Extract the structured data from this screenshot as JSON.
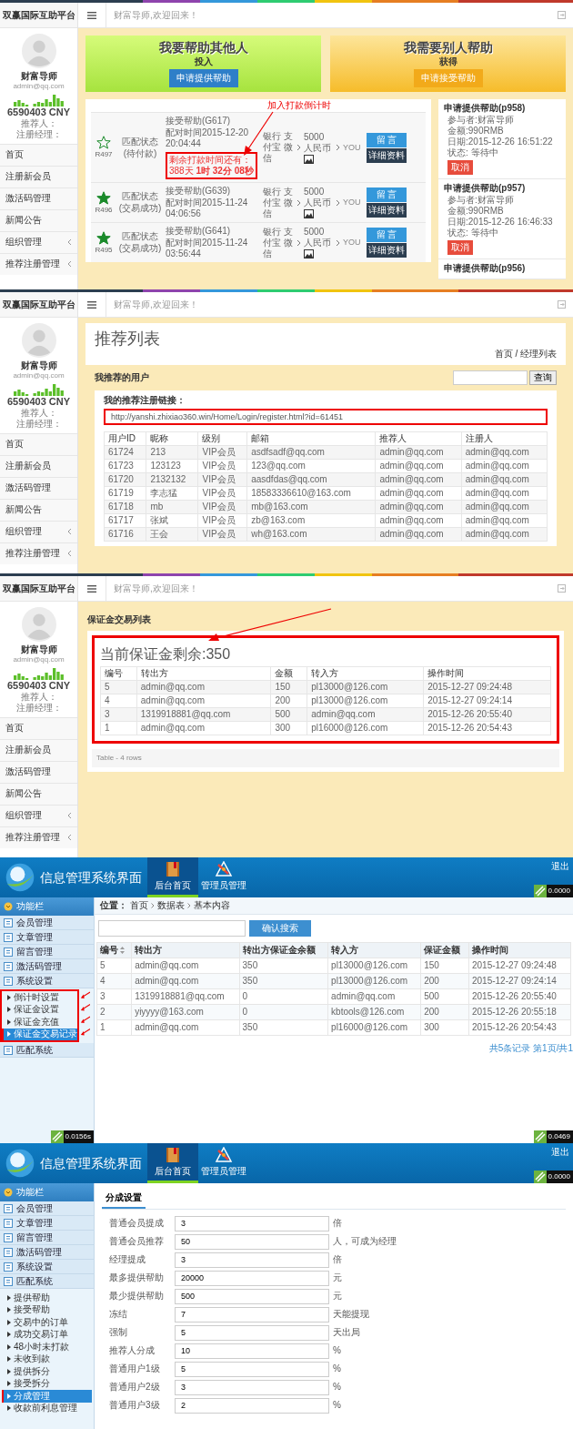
{
  "screens": [
    {
      "kind": "member_help",
      "header": {
        "brand": "双赢国际互助平台",
        "welcome": "财富导师,欢迎回来！"
      },
      "sidebar": {
        "name": "财富导师",
        "email": "admin@qq.com",
        "balance": "6590403 CNY",
        "referrer": "推荐人：",
        "manager": "注册经理：",
        "menu": [
          {
            "label": "首页",
            "has_submenu": false
          },
          {
            "label": "注册新会员",
            "has_submenu": false
          },
          {
            "label": "激活码管理",
            "has_submenu": false
          },
          {
            "label": "新闻公告",
            "has_submenu": false
          },
          {
            "label": "组织管理",
            "has_submenu": true
          },
          {
            "label": "推荐注册管理",
            "has_submenu": true
          }
        ]
      },
      "banners": [
        {
          "kind": "give",
          "title": "我要帮助其他人",
          "subtitle": "投入",
          "button": "申请提供帮助"
        },
        {
          "kind": "receive",
          "title": "我需要别人帮助",
          "subtitle": "获得",
          "button": "申请接受帮助"
        }
      ],
      "annotation": "加入打款倒计时",
      "matches": [
        {
          "id": "R497",
          "starred": false,
          "status": "匹配状态",
          "status_detail": "(待付款)",
          "order": "接受帮助(G617)",
          "paired": "配对时间2015-12-20 20:04:44",
          "countdown": {
            "label": "剩余打款时间还有：",
            "time": "388天 **1时 32分 08秒**",
            "highlighted": true
          },
          "payment": "银行 支付宝 微信",
          "amount": "5000 人民币",
          "receiver": "YOU",
          "buttons": [
            "留 言",
            "详细资料"
          ]
        },
        {
          "id": "R496",
          "starred": true,
          "status": "匹配状态",
          "status_detail": "(交易成功)",
          "order": "接受帮助(G639)",
          "paired": "配对时间2015-11-24 04:06:56",
          "payment": "银行 支付宝 微信",
          "amount": "5000 人民币",
          "receiver": "YOU",
          "buttons": [
            "留 言",
            "详细资料"
          ]
        },
        {
          "id": "R495",
          "starred": true,
          "status": "匹配状态",
          "status_detail": "(交易成功)",
          "order": "接受帮助(G641)",
          "paired": "配对时间2015-11-24 03:56:44",
          "payment": "银行 支付宝 微信",
          "amount": "5000 人民币",
          "receiver": "YOU",
          "buttons": [
            "留 言",
            "详细资料"
          ]
        }
      ],
      "requests": [
        {
          "title": "申请提供帮助(p958)",
          "lines": [
            "参与者:财富导师",
            "金额:990RMB",
            "日期:2015-12-26 16:51:22",
            "状态: 等待中"
          ],
          "button": "取消"
        },
        {
          "title": "申请提供帮助(p957)",
          "lines": [
            "参与者:财富导师",
            "金额:990RMB",
            "日期:2015-12-26 16:46:33",
            "状态: 等待中"
          ],
          "button": "取消"
        },
        {
          "title": "申请提供帮助(p956)"
        }
      ]
    },
    {
      "kind": "referral_list",
      "header": {
        "brand": "双赢国际互助平台",
        "welcome": "财富导师,欢迎回来！"
      },
      "sidebar": {
        "name": "财富导师",
        "email": "admin@qq.com",
        "balance": "6590403 CNY",
        "referrer": "推荐人：",
        "manager": "注册经理：",
        "menu": [
          {
            "label": "首页",
            "has_submenu": false
          },
          {
            "label": "注册新会员",
            "has_submenu": false
          },
          {
            "label": "激活码管理",
            "has_submenu": false
          },
          {
            "label": "新闻公告",
            "has_submenu": false
          },
          {
            "label": "组织管理",
            "has_submenu": true
          },
          {
            "label": "推荐注册管理",
            "has_submenu": true
          }
        ]
      },
      "page_title": "推荐列表",
      "breadcrumb": "首页 / 经理列表",
      "section_title": "我推荐的用户",
      "search_button": "查询",
      "link_label": "我的推荐注册链接：",
      "link": {
        "value": "http://yanshi.zhixiao360.win/Home/Login/register.html?id=61451",
        "highlighted": true
      },
      "table": {
        "columns": [
          "用户ID",
          "昵称",
          "级别",
          "邮箱",
          "推荐人",
          "注册人"
        ],
        "rows": [
          [
            "61724",
            "213",
            "VIP会员",
            "asdfsadf@qq.com",
            "admin@qq.com",
            "admin@qq.com"
          ],
          [
            "61723",
            "123123",
            "VIP会员",
            "123@qq.com",
            "admin@qq.com",
            "admin@qq.com"
          ],
          [
            "61720",
            "2132132",
            "VIP会员",
            "aasdfdas@qq.com",
            "admin@qq.com",
            "admin@qq.com"
          ],
          [
            "61719",
            "李志猛",
            "VIP会员",
            "18583336610@163.com",
            "admin@qq.com",
            "admin@qq.com"
          ],
          [
            "61718",
            "mb",
            "VIP会员",
            "mb@163.com",
            "admin@qq.com",
            "admin@qq.com"
          ],
          [
            "61717",
            "张斌",
            "VIP会员",
            "zb@163.com",
            "admin@qq.com",
            "admin@qq.com"
          ],
          [
            "61716",
            "王会",
            "VIP会员",
            "wh@163.com",
            "admin@qq.com",
            "admin@qq.com"
          ]
        ]
      }
    },
    {
      "kind": "deposit_list",
      "header": {
        "brand": "双赢国际互助平台",
        "welcome": "财富导师,欢迎回来！"
      },
      "sidebar": {
        "name": "财富导师",
        "email": "admin@qq.com",
        "balance": "6590403 CNY",
        "referrer": "推荐人：",
        "manager": "注册经理：",
        "menu": [
          {
            "label": "首页",
            "has_submenu": false
          },
          {
            "label": "注册新会员",
            "has_submenu": false
          },
          {
            "label": "激活码管理",
            "has_submenu": false
          },
          {
            "label": "新闻公告",
            "has_submenu": false
          },
          {
            "label": "组织管理",
            "has_submenu": true
          },
          {
            "label": "推荐注册管理",
            "has_submenu": true
          }
        ]
      },
      "section_title": "保证金交易列表",
      "balance": {
        "text": "当前保证金剩余:350",
        "highlighted": true
      },
      "table": {
        "columns": [
          "编号",
          "转出方",
          "金额",
          "转入方",
          "操作时间"
        ],
        "rows": [
          [
            "5",
            "admin@qq.com",
            "150",
            "pl13000@126.com",
            "2015-12-27 09:24:48"
          ],
          [
            "4",
            "admin@qq.com",
            "200",
            "pl13000@126.com",
            "2015-12-27 09:24:14"
          ],
          [
            "3",
            "1319918881@qq.com",
            "500",
            "admin@qq.com",
            "2015-12-26 20:55:40"
          ],
          [
            "1",
            "admin@qq.com",
            "300",
            "pl16000@126.com",
            "2015-12-26 20:54:43"
          ]
        ]
      },
      "footer": "Table - 4 rows"
    },
    {
      "kind": "admin_records",
      "header": {
        "title": "信息管理系统界面",
        "tabs": [
          {
            "label": "后台首页",
            "selected": true
          },
          {
            "label": "管理员管理",
            "selected": false
          }
        ],
        "logout": "退出",
        "timer": "0.0000"
      },
      "sidebar": {
        "title": "功能栏",
        "groups": [
          {
            "label": "会员管理"
          },
          {
            "label": "文章管理"
          },
          {
            "label": "留言管理"
          },
          {
            "label": "激活码管理"
          },
          {
            "label": "系统设置",
            "highlighted": true,
            "children": [
              {
                "label": "倒计时设置",
                "selected": false
              },
              {
                "label": "保证金设置",
                "selected": false
              },
              {
                "label": "保证金充值",
                "selected": false
              },
              {
                "label": "保证金交易记录",
                "selected": true
              }
            ]
          },
          {
            "label": "匹配系统"
          }
        ]
      },
      "sidebar_timer": "0.0156s",
      "location": {
        "label": "位置：",
        "path": [
          "首页",
          "数据表",
          "基本内容"
        ]
      },
      "search_button": "确认搜索",
      "table": {
        "columns": [
          {
            "label": "编号",
            "sortable": true
          },
          {
            "label": "转出方",
            "sortable": false
          },
          {
            "label": "转出方保证金余额",
            "sortable": false
          },
          {
            "label": "转入方",
            "sortable": false
          },
          {
            "label": "保证金额",
            "sortable": false
          },
          {
            "label": "操作时间",
            "sortable": false
          }
        ],
        "rows": [
          [
            "5",
            "admin@qq.com",
            "350",
            "pl13000@126.com",
            "150",
            "2015-12-27 09:24:48"
          ],
          [
            "4",
            "admin@qq.com",
            "350",
            "pl13000@126.com",
            "200",
            "2015-12-27 09:24:14"
          ],
          [
            "3",
            "1319918881@qq.com",
            "0",
            "admin@qq.com",
            "500",
            "2015-12-26 20:55:40"
          ],
          [
            "2",
            "yiyyyy@163.com",
            "0",
            "kbtools@126.com",
            "200",
            "2015-12-26 20:55:18"
          ],
          [
            "1",
            "admin@qq.com",
            "350",
            "pl16000@126.com",
            "300",
            "2015-12-26 20:54:43"
          ]
        ]
      },
      "pagination": "共5条记录 第1页/共1",
      "main_timer": "0.0469"
    },
    {
      "kind": "admin_settings",
      "header": {
        "title": "信息管理系统界面",
        "tabs": [
          {
            "label": "后台首页",
            "selected": true
          },
          {
            "label": "管理员管理",
            "selected": false
          }
        ],
        "logout": "退出",
        "timer": "0.0000"
      },
      "sidebar": {
        "title": "功能栏",
        "groups": [
          {
            "label": "会员管理"
          },
          {
            "label": "文章管理"
          },
          {
            "label": "留言管理"
          },
          {
            "label": "激活码管理"
          },
          {
            "label": "系统设置"
          },
          {
            "label": "匹配系统",
            "highlighted": false,
            "children": [
              {
                "label": "提供帮助",
                "selected": false
              },
              {
                "label": "接受帮助",
                "selected": false
              },
              {
                "label": "交易中的订单",
                "selected": false
              },
              {
                "label": "成功交易订单",
                "selected": false
              },
              {
                "label": "48小时未打款",
                "selected": false
              },
              {
                "label": "未收到款",
                "selected": false
              },
              {
                "label": "提供拆分",
                "selected": false
              },
              {
                "label": "接受拆分",
                "selected": false
              },
              {
                "label": "分成管理",
                "selected": true
              },
              {
                "label": "收款前利息管理",
                "selected": false
              }
            ]
          }
        ]
      },
      "tabs": [
        {
          "label": "分成设置",
          "selected": true
        }
      ],
      "fields": [
        {
          "label": "普通会员提成",
          "value": "3",
          "unit": "倍"
        },
        {
          "label": "普通会员推荐",
          "value": "50",
          "unit": "人，可成为经理"
        },
        {
          "label": "经理提成",
          "value": "3",
          "unit": "倍"
        },
        {
          "label": "最多提供帮助",
          "value": "20000",
          "unit": "元"
        },
        {
          "label": "最少提供帮助",
          "value": "500",
          "unit": "元"
        },
        {
          "label": "冻结",
          "value": "7",
          "unit": "天能提现"
        },
        {
          "label": "强制",
          "value": "5",
          "unit": "天出局"
        },
        {
          "label": "推荐人分成",
          "value": "10",
          "unit": "%"
        },
        {
          "label": "普通用户1级",
          "value": "5",
          "unit": "%"
        },
        {
          "label": "普通用户2级",
          "value": "3",
          "unit": "%"
        },
        {
          "label": "普通用户3级",
          "value": "2",
          "unit": "%"
        }
      ]
    }
  ]
}
